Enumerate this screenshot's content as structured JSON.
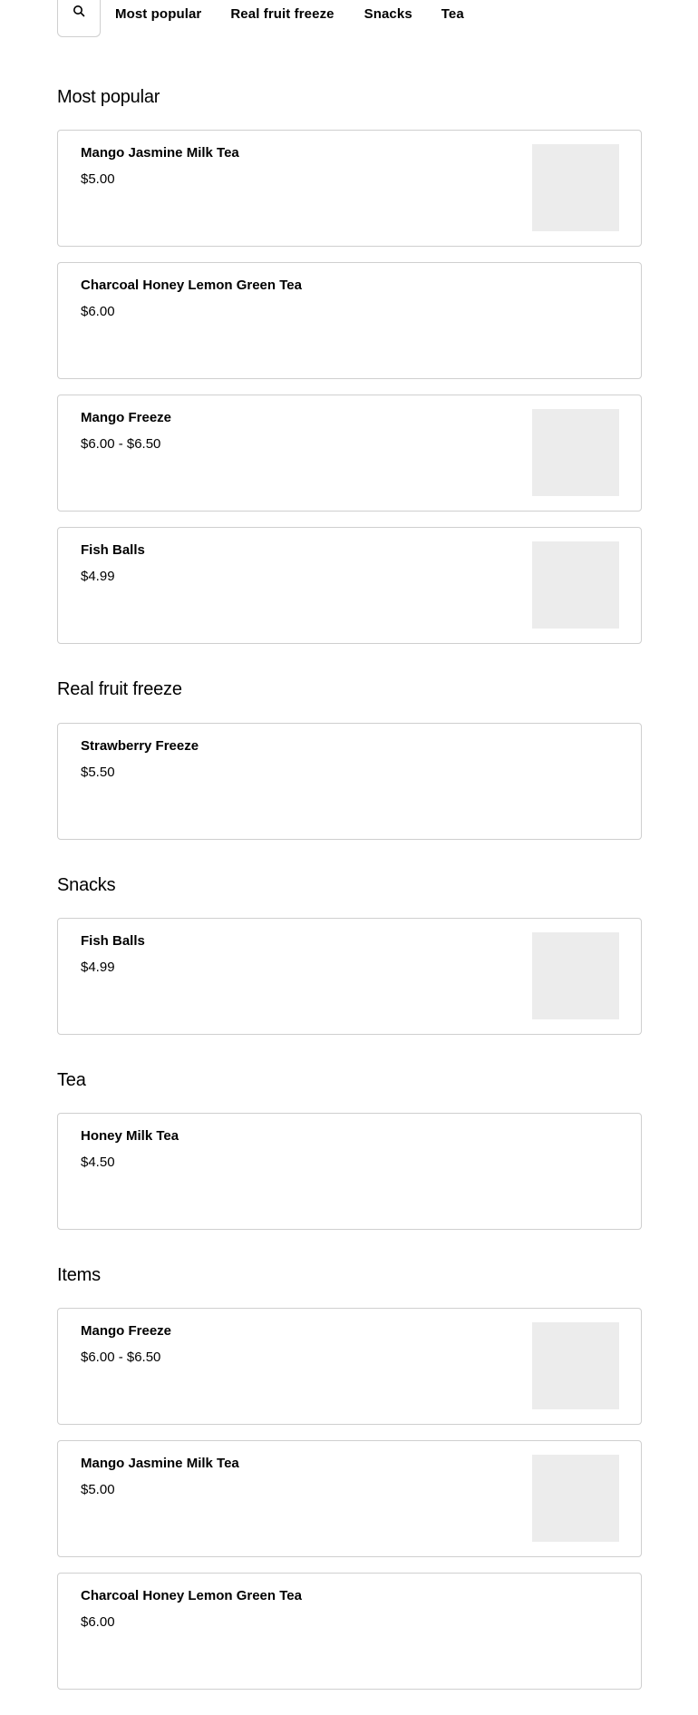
{
  "nav": {
    "search_icon": "search-icon",
    "links": [
      "Most popular",
      "Real fruit freeze",
      "Snacks",
      "Tea"
    ]
  },
  "sections": [
    {
      "title": "Most popular",
      "items": [
        {
          "name": "Mango Jasmine Milk Tea",
          "price": "$5.00",
          "image": true
        },
        {
          "name": "Charcoal Honey Lemon Green Tea",
          "price": "$6.00",
          "image": false
        },
        {
          "name": "Mango Freeze",
          "price": "$6.00 - $6.50",
          "image": true
        },
        {
          "name": "Fish Balls",
          "price": "$4.99",
          "image": true
        }
      ]
    },
    {
      "title": "Real fruit freeze",
      "items": [
        {
          "name": "Strawberry Freeze",
          "price": "$5.50",
          "image": false
        }
      ]
    },
    {
      "title": "Snacks",
      "items": [
        {
          "name": "Fish Balls",
          "price": "$4.99",
          "image": true
        }
      ]
    },
    {
      "title": "Tea",
      "items": [
        {
          "name": "Honey Milk Tea",
          "price": "$4.50",
          "image": false
        }
      ]
    },
    {
      "title": "Items",
      "items": [
        {
          "name": "Mango Freeze",
          "price": "$6.00 - $6.50",
          "image": true
        },
        {
          "name": "Mango Jasmine Milk Tea",
          "price": "$5.00",
          "image": true
        },
        {
          "name": "Charcoal Honey Lemon Green Tea",
          "price": "$6.00",
          "image": false
        }
      ]
    }
  ],
  "colors": {
    "border": "#cfcfcf",
    "thumb_placeholder": "#ececec",
    "text": "#000000"
  }
}
